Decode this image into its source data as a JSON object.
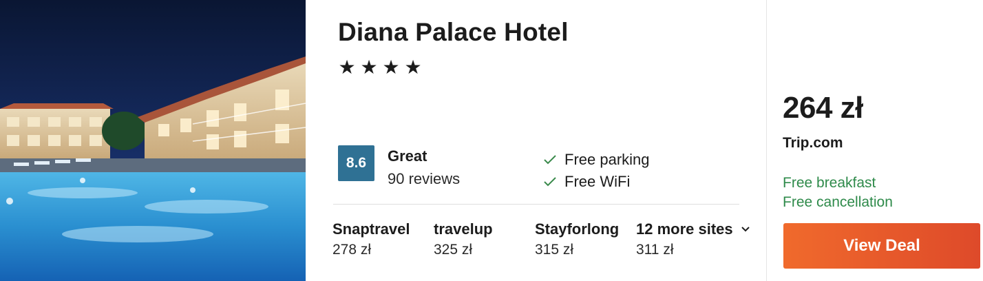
{
  "hotel": {
    "name": "Diana Palace Hotel",
    "star_count": 4,
    "stars": [
      "★",
      "★",
      "★",
      "★"
    ]
  },
  "rating": {
    "score": "8.6",
    "label": "Great",
    "reviews": "90 reviews"
  },
  "amenities": [
    "Free parking",
    "Free WiFi"
  ],
  "sites": [
    {
      "name": "Snaptravel",
      "price": "278 zł"
    },
    {
      "name": "travelup",
      "price": "325 zł"
    },
    {
      "name": "Stayforlong",
      "price": "315 zł"
    },
    {
      "name": "12 more sites",
      "price": "311 zł"
    }
  ],
  "deal": {
    "price": "264 zł",
    "provider": "Trip.com",
    "perks": [
      "Free breakfast",
      "Free cancellation"
    ],
    "button_label": "View Deal"
  },
  "colors": {
    "score_badge": "#2f7194",
    "perk_green": "#2e8a4a",
    "check_green": "#3a8a4c",
    "button_start": "#f06a2c",
    "button_end": "#de4a2a"
  }
}
